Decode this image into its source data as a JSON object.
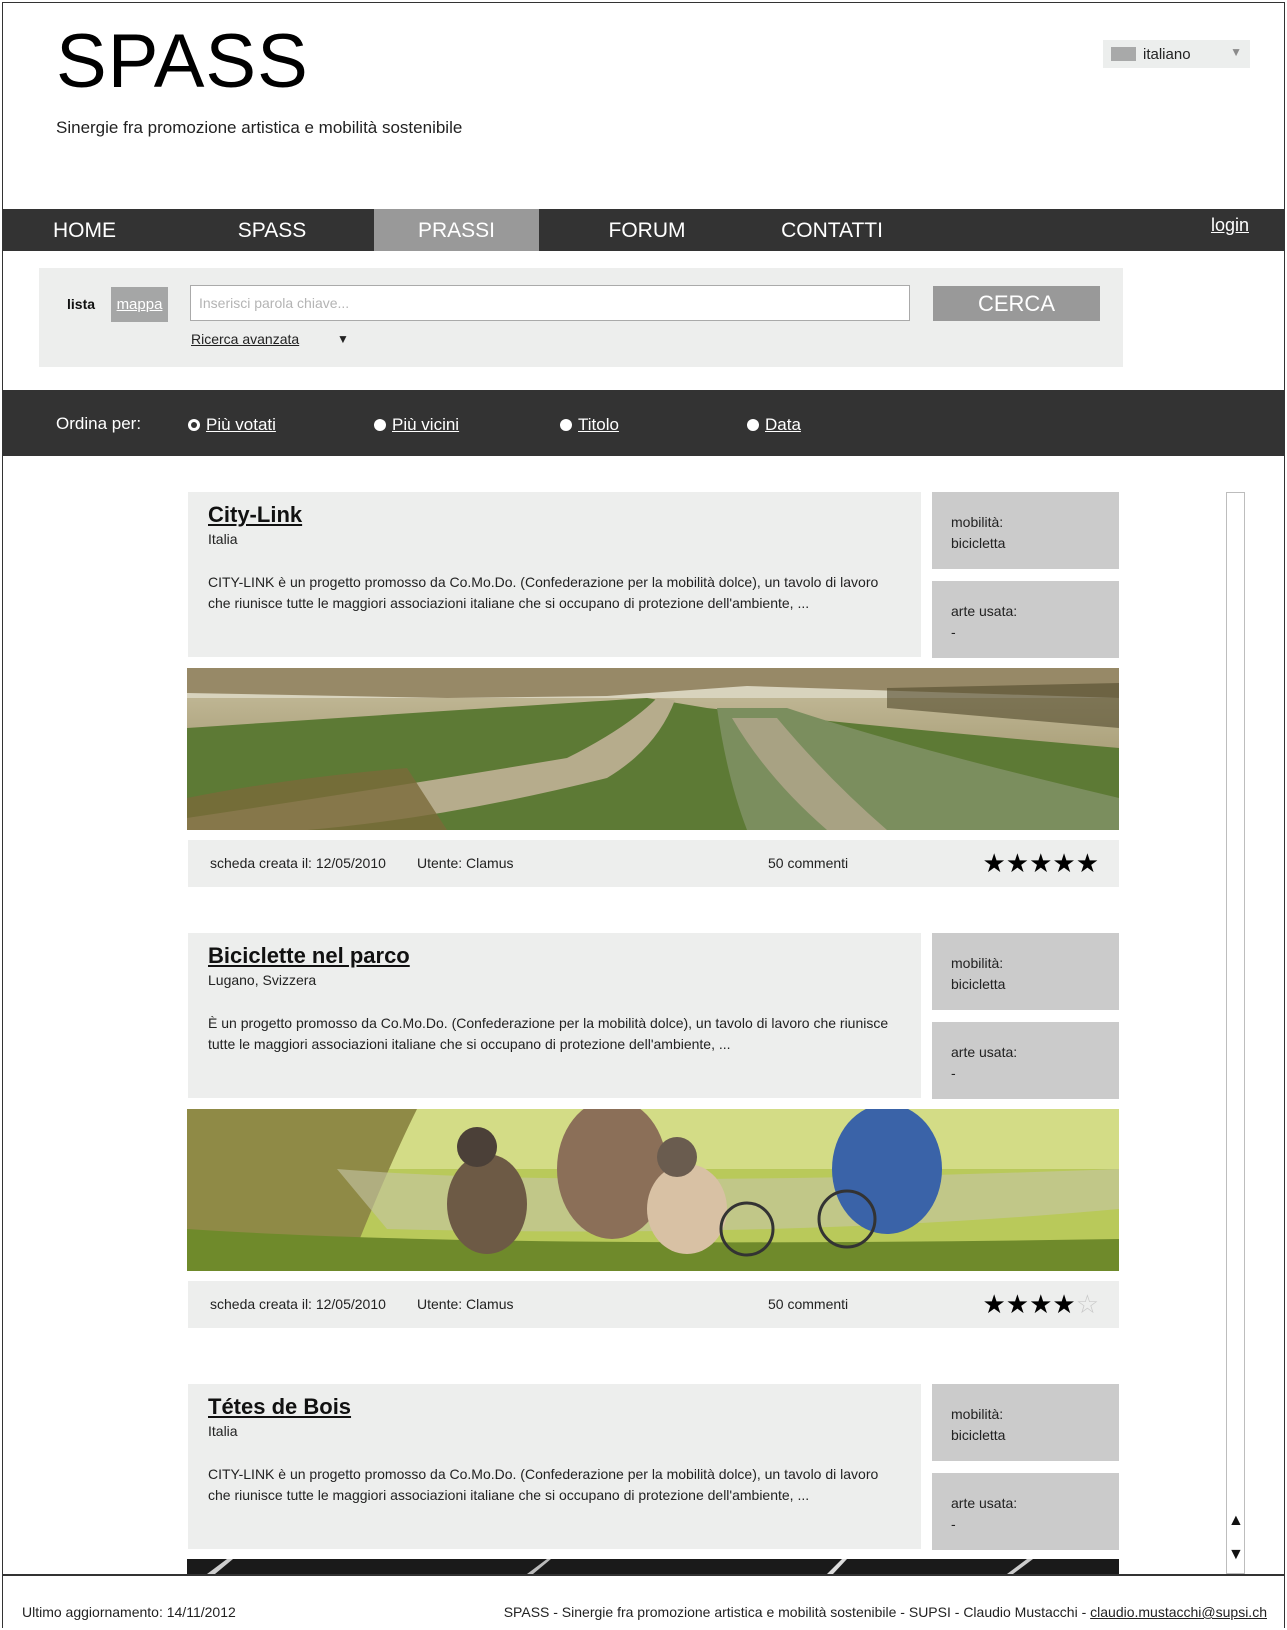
{
  "header": {
    "logo": "SPASS",
    "tagline": "Sinergie fra promozione artistica e mobilità sostenibile",
    "language": "italiano"
  },
  "nav": {
    "items": [
      "HOME",
      "SPASS",
      "PRASSI",
      "FORUM",
      "CONTATTI"
    ],
    "active": "PRASSI",
    "login": "login"
  },
  "search": {
    "tab_list": "lista",
    "tab_map": "mappa",
    "placeholder": "Inserisci parola chiave...",
    "button": "CERCA",
    "advanced": "Ricerca avanzata"
  },
  "sort": {
    "label": "Ordina per:",
    "options": [
      "Più votati",
      "Più vicini",
      "Titolo",
      "Data"
    ],
    "selected": "Più votati"
  },
  "listings": [
    {
      "title": "City-Link",
      "location": "Italia",
      "description": "CITY-LINK è un progetto promosso da Co.Mo.Do. (Confederazione per la mobilità dolce), un tavolo di lavoro che riunisce tutte le maggiori associazioni italiane che si occupano di protezione dell'ambiente, ...",
      "mobility_label": "mobilità:",
      "mobility": "bicicletta",
      "art_label": "arte usata:",
      "art": "-",
      "created": "scheda creata il: 12/05/2010",
      "user": "Utente: Clamus",
      "comments": "50 commenti",
      "rating": 5
    },
    {
      "title": "Biciclette nel parco",
      "location": "Lugano, Svizzera",
      "description": "È un progetto promosso da Co.Mo.Do. (Confederazione per la mobilità dolce), un tavolo di lavoro che riunisce tutte le maggiori associazioni italiane che si occupano di protezione dell'ambiente, ...",
      "mobility_label": "mobilità:",
      "mobility": "bicicletta",
      "art_label": "arte usata:",
      "art": "-",
      "created": "scheda creata il: 12/05/2010",
      "user": "Utente: Clamus",
      "comments": "50 commenti",
      "rating": 4
    },
    {
      "title": "Tétes de Bois",
      "location": "Italia",
      "description": "CITY-LINK è un progetto promosso da Co.Mo.Do. (Confederazione per la mobilità dolce), un tavolo di lavoro che riunisce tutte le maggiori associazioni italiane che si occupano di protezione dell'ambiente, ...",
      "mobility_label": "mobilità:",
      "mobility": "bicicletta",
      "art_label": "arte usata:",
      "art": "-"
    }
  ],
  "footer": {
    "updated": "Ultimo aggiornamento: 14/11/2012",
    "credits": "SPASS - Sinergie fra promozione artistica e mobilità sostenibile - SUPSI - Claudio Mustacchi - ",
    "email": "claudio.mustacchi@supsi.ch"
  }
}
